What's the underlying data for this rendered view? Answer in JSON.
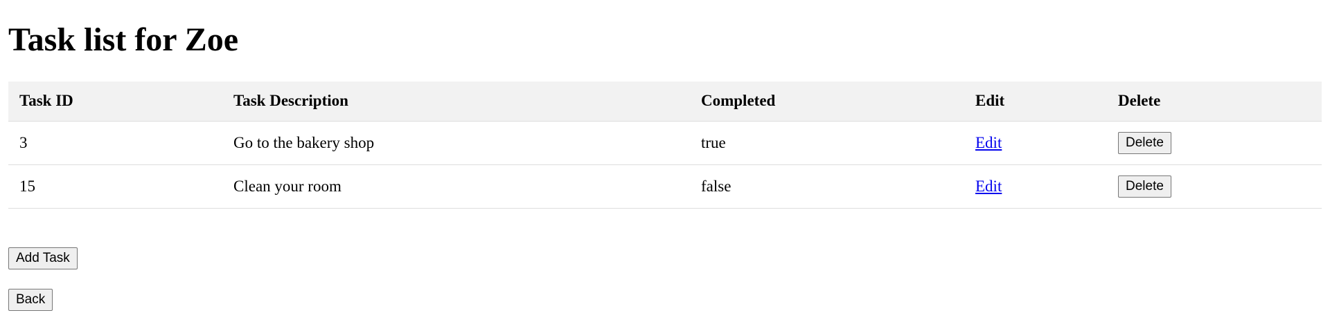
{
  "page": {
    "title": "Task list for Zoe"
  },
  "table": {
    "headers": {
      "task_id": "Task ID",
      "description": "Task Description",
      "completed": "Completed",
      "edit": "Edit",
      "delete": "Delete"
    },
    "rows": [
      {
        "task_id": "3",
        "description": "Go to the bakery shop",
        "completed": "true",
        "edit_label": "Edit",
        "delete_label": "Delete"
      },
      {
        "task_id": "15",
        "description": "Clean your room",
        "completed": "false",
        "edit_label": "Edit",
        "delete_label": "Delete"
      }
    ]
  },
  "actions": {
    "add_task_label": "Add Task",
    "back_label": "Back"
  },
  "colors": {
    "header_background": "#f2f2f2",
    "row_divider": "#dddddd",
    "link": "#0000ee"
  }
}
